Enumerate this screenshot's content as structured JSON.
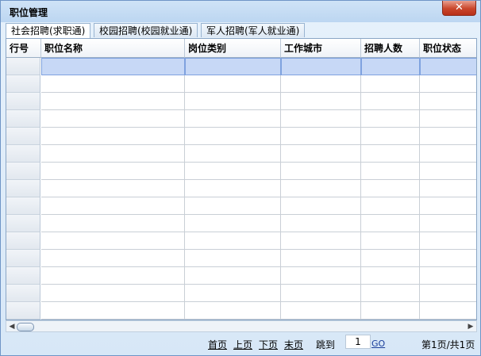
{
  "window": {
    "title": "职位管理",
    "close_label": "✕"
  },
  "tabs": [
    {
      "label": "社会招聘(求职通)",
      "active": true
    },
    {
      "label": "校园招聘(校园就业通)",
      "active": false
    },
    {
      "label": "军人招聘(军人就业通)",
      "active": false
    }
  ],
  "table": {
    "columns": [
      "行号",
      "职位名称",
      "岗位类别",
      "工作城市",
      "招聘人数",
      "职位状态"
    ],
    "row_count": 15,
    "selected_row": 0
  },
  "scrollbar": {
    "left_arrow": "◀",
    "right_arrow": "▶"
  },
  "pager": {
    "first": "首页",
    "prev": "上页",
    "next": "下页",
    "last": "末页",
    "jump_label": "跳到",
    "page_value": "1",
    "go": "GO",
    "status": "第1页/共1页"
  }
}
